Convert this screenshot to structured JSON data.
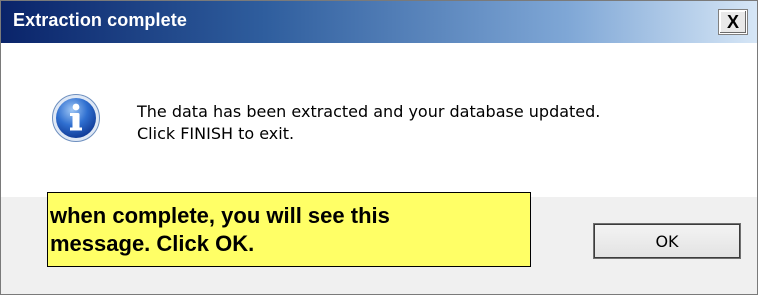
{
  "window": {
    "title": "Extraction complete",
    "close_label": "X"
  },
  "message": {
    "line1": "The data has been extracted and your database updated.",
    "line2": "Click FINISH to exit.",
    "icon": "info-icon"
  },
  "note": {
    "line1": "when complete, you will see this",
    "line2": "message. Click OK."
  },
  "buttons": {
    "ok_label": "OK"
  },
  "colors": {
    "titlebar_start": "#0a246a",
    "titlebar_end": "#d6e6f6",
    "note_background": "#ffff66",
    "dialog_background": "#f0f0f0"
  }
}
